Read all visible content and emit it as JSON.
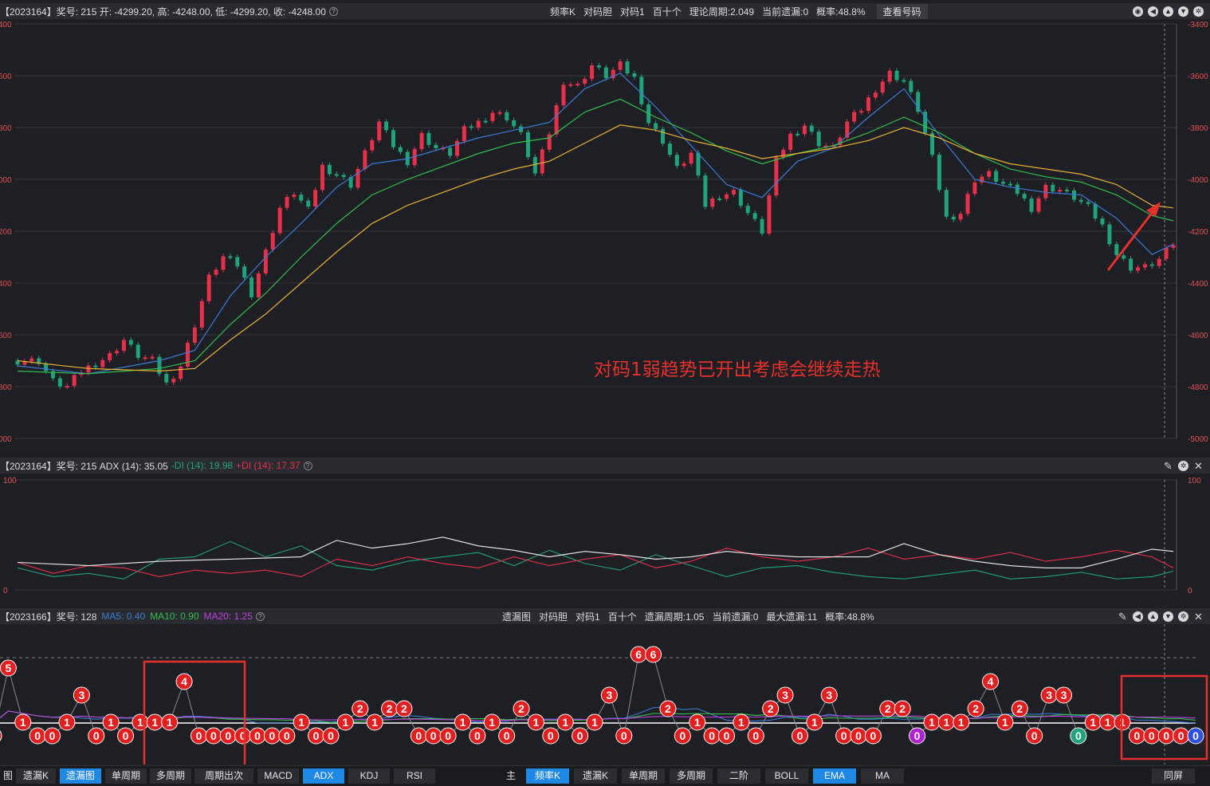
{
  "main_header": {
    "info": "【2023164】奖号: 215  开: -4299.20, 高: -4248.00, 低: -4299.20, 收: -4248.00",
    "center_items": [
      "频率K",
      "对码胆",
      "对码1",
      "百十个",
      "理论周期:2.049",
      "当前遗漏:0",
      "概率:48.8%"
    ],
    "button": "查看号码"
  },
  "adx_header": {
    "info": "【2023164】奖号: 215 ADX (14): 35.05",
    "di_minus": "-DI (14): 19.98",
    "di_plus": "+DI (14): 17.37"
  },
  "miss_header": {
    "info": "【2023166】奖号: 128",
    "ma5": "MA5: 0.40",
    "ma10": "MA10: 0.90",
    "ma20": "MA20: 1.25",
    "center_items": [
      "遗漏图",
      "对码胆",
      "对码1",
      "百十个",
      "遗漏周期:1.05",
      "当前遗漏:0",
      "最大遗漏:11",
      "概率:48.8%"
    ]
  },
  "annotation": "对码1弱趋势已开出考虑会继续走热",
  "bottom_tabs_left": [
    "图",
    "遗漏K",
    "遗漏图",
    "单周期",
    "多周期",
    "周期出次",
    "MACD",
    "ADX",
    "KDJ",
    "RSI"
  ],
  "bottom_tabs_right": [
    "主图",
    "频率K",
    "遗漏K",
    "单周期",
    "多周期",
    "二阶",
    "BOLL",
    "EMA",
    "MA"
  ],
  "bottom_sync": "同屏",
  "colors": {
    "up": "#e8304a",
    "down": "#1fa37a",
    "ema_fast": "#3a7bd5",
    "ema_mid": "#2ec04a",
    "ema_slow": "#e8b030",
    "annot": "#e8302a",
    "active_tab": "#1e88e5"
  },
  "chart_data": [
    {
      "type": "candlestick",
      "title": "",
      "ylim": [
        -5000,
        -3400
      ],
      "y_ticks": [
        "-3400",
        "-3600",
        "-3800",
        "-4000",
        "-4200",
        "-4400",
        "-4600",
        "-4800",
        "-5000"
      ],
      "left_ticks": [
        "400",
        "600",
        "800",
        "000",
        "200",
        "400",
        "600",
        "800",
        "000"
      ],
      "trend_path": [
        [
          0,
          -4700
        ],
        [
          3,
          -4700
        ],
        [
          5,
          -4780
        ],
        [
          7,
          -4800
        ],
        [
          9,
          -4740
        ],
        [
          11,
          -4710
        ],
        [
          13,
          -4680
        ],
        [
          15,
          -4620
        ],
        [
          17,
          -4680
        ],
        [
          19,
          -4700
        ],
        [
          21,
          -4790
        ],
        [
          23,
          -4720
        ],
        [
          25,
          -4560
        ],
        [
          27,
          -4380
        ],
        [
          29,
          -4300
        ],
        [
          31,
          -4330
        ],
        [
          33,
          -4440
        ],
        [
          35,
          -4280
        ],
        [
          37,
          -4110
        ],
        [
          39,
          -4050
        ],
        [
          41,
          -4120
        ],
        [
          43,
          -3950
        ],
        [
          45,
          -3980
        ],
        [
          47,
          -4020
        ],
        [
          49,
          -3900
        ],
        [
          51,
          -3780
        ],
        [
          53,
          -3870
        ],
        [
          55,
          -3930
        ],
        [
          57,
          -3830
        ],
        [
          59,
          -3880
        ],
        [
          61,
          -3900
        ],
        [
          63,
          -3810
        ],
        [
          65,
          -3780
        ],
        [
          67,
          -3740
        ],
        [
          69,
          -3760
        ],
        [
          71,
          -3830
        ],
        [
          73,
          -3980
        ],
        [
          75,
          -3820
        ],
        [
          77,
          -3620
        ],
        [
          79,
          -3640
        ],
        [
          81,
          -3560
        ],
        [
          83,
          -3600
        ],
        [
          85,
          -3560
        ],
        [
          87,
          -3610
        ],
        [
          89,
          -3780
        ],
        [
          91,
          -3850
        ],
        [
          93,
          -3960
        ],
        [
          95,
          -3900
        ],
        [
          97,
          -4100
        ],
        [
          99,
          -4060
        ],
        [
          101,
          -4050
        ],
        [
          103,
          -4130
        ],
        [
          105,
          -4200
        ],
        [
          107,
          -3930
        ],
        [
          109,
          -3830
        ],
        [
          111,
          -3790
        ],
        [
          113,
          -3860
        ],
        [
          115,
          -3880
        ],
        [
          117,
          -3780
        ],
        [
          119,
          -3730
        ],
        [
          121,
          -3650
        ],
        [
          123,
          -3590
        ],
        [
          125,
          -3620
        ],
        [
          127,
          -3730
        ],
        [
          129,
          -3920
        ],
        [
          131,
          -4150
        ],
        [
          133,
          -4130
        ],
        [
          135,
          -4000
        ],
        [
          137,
          -3980
        ],
        [
          139,
          -4020
        ],
        [
          141,
          -4050
        ],
        [
          143,
          -4110
        ],
        [
          145,
          -4030
        ],
        [
          147,
          -4040
        ],
        [
          149,
          -4070
        ],
        [
          151,
          -4110
        ],
        [
          153,
          -4180
        ],
        [
          155,
          -4290
        ],
        [
          157,
          -4340
        ],
        [
          159,
          -4340
        ],
        [
          161,
          -4310
        ],
        [
          163,
          -4248
        ]
      ],
      "ema_fast": [
        [
          0,
          -4720
        ],
        [
          10,
          -4750
        ],
        [
          20,
          -4700
        ],
        [
          25,
          -4660
        ],
        [
          30,
          -4450
        ],
        [
          35,
          -4300
        ],
        [
          40,
          -4170
        ],
        [
          45,
          -4030
        ],
        [
          50,
          -3940
        ],
        [
          55,
          -3920
        ],
        [
          60,
          -3880
        ],
        [
          65,
          -3840
        ],
        [
          70,
          -3810
        ],
        [
          75,
          -3780
        ],
        [
          80,
          -3650
        ],
        [
          85,
          -3590
        ],
        [
          90,
          -3720
        ],
        [
          95,
          -3870
        ],
        [
          100,
          -4020
        ],
        [
          105,
          -4070
        ],
        [
          110,
          -3930
        ],
        [
          115,
          -3880
        ],
        [
          120,
          -3760
        ],
        [
          125,
          -3650
        ],
        [
          130,
          -3830
        ],
        [
          135,
          -4000
        ],
        [
          140,
          -4030
        ],
        [
          145,
          -4050
        ],
        [
          150,
          -4060
        ],
        [
          155,
          -4150
        ],
        [
          160,
          -4290
        ],
        [
          163,
          -4250
        ]
      ],
      "ema_mid": [
        [
          0,
          -4740
        ],
        [
          10,
          -4750
        ],
        [
          20,
          -4730
        ],
        [
          25,
          -4700
        ],
        [
          30,
          -4560
        ],
        [
          35,
          -4440
        ],
        [
          40,
          -4300
        ],
        [
          45,
          -4170
        ],
        [
          50,
          -4060
        ],
        [
          55,
          -4000
        ],
        [
          60,
          -3950
        ],
        [
          65,
          -3900
        ],
        [
          70,
          -3860
        ],
        [
          75,
          -3840
        ],
        [
          80,
          -3740
        ],
        [
          85,
          -3690
        ],
        [
          90,
          -3760
        ],
        [
          95,
          -3820
        ],
        [
          100,
          -3890
        ],
        [
          105,
          -3940
        ],
        [
          110,
          -3900
        ],
        [
          115,
          -3870
        ],
        [
          120,
          -3820
        ],
        [
          125,
          -3760
        ],
        [
          130,
          -3820
        ],
        [
          135,
          -3900
        ],
        [
          140,
          -3960
        ],
        [
          145,
          -3990
        ],
        [
          150,
          -4010
        ],
        [
          155,
          -4060
        ],
        [
          160,
          -4140
        ],
        [
          163,
          -4160
        ]
      ],
      "ema_slow": [
        [
          0,
          -4700
        ],
        [
          10,
          -4730
        ],
        [
          20,
          -4740
        ],
        [
          25,
          -4730
        ],
        [
          30,
          -4620
        ],
        [
          35,
          -4520
        ],
        [
          40,
          -4400
        ],
        [
          45,
          -4280
        ],
        [
          50,
          -4170
        ],
        [
          55,
          -4100
        ],
        [
          60,
          -4050
        ],
        [
          65,
          -4000
        ],
        [
          70,
          -3960
        ],
        [
          75,
          -3930
        ],
        [
          80,
          -3860
        ],
        [
          85,
          -3790
        ],
        [
          90,
          -3810
        ],
        [
          95,
          -3850
        ],
        [
          100,
          -3880
        ],
        [
          105,
          -3920
        ],
        [
          110,
          -3900
        ],
        [
          115,
          -3880
        ],
        [
          120,
          -3850
        ],
        [
          125,
          -3800
        ],
        [
          130,
          -3840
        ],
        [
          135,
          -3900
        ],
        [
          140,
          -3940
        ],
        [
          145,
          -3960
        ],
        [
          150,
          -3980
        ],
        [
          155,
          -4020
        ],
        [
          160,
          -4100
        ],
        [
          163,
          -4110
        ]
      ]
    },
    {
      "type": "line",
      "title": "ADX",
      "ylim": [
        0,
        100
      ],
      "y_ticks": [
        "100",
        "0"
      ],
      "adx": [
        [
          0,
          25
        ],
        [
          10,
          22
        ],
        [
          20,
          26
        ],
        [
          30,
          28
        ],
        [
          40,
          30
        ],
        [
          45,
          45
        ],
        [
          50,
          38
        ],
        [
          55,
          42
        ],
        [
          60,
          48
        ],
        [
          65,
          40
        ],
        [
          70,
          36
        ],
        [
          75,
          30
        ],
        [
          80,
          35
        ],
        [
          85,
          32
        ],
        [
          90,
          28
        ],
        [
          95,
          30
        ],
        [
          100,
          35
        ],
        [
          105,
          32
        ],
        [
          110,
          30
        ],
        [
          115,
          30
        ],
        [
          120,
          30
        ],
        [
          125,
          42
        ],
        [
          130,
          32
        ],
        [
          135,
          26
        ],
        [
          140,
          22
        ],
        [
          145,
          20
        ],
        [
          150,
          20
        ],
        [
          155,
          28
        ],
        [
          160,
          37
        ],
        [
          163,
          35
        ]
      ],
      "di_minus": [
        [
          0,
          25
        ],
        [
          5,
          15
        ],
        [
          10,
          22
        ],
        [
          15,
          20
        ],
        [
          20,
          12
        ],
        [
          25,
          18
        ],
        [
          30,
          15
        ],
        [
          35,
          18
        ],
        [
          40,
          12
        ],
        [
          45,
          28
        ],
        [
          50,
          22
        ],
        [
          55,
          30
        ],
        [
          60,
          24
        ],
        [
          65,
          20
        ],
        [
          70,
          30
        ],
        [
          75,
          22
        ],
        [
          80,
          28
        ],
        [
          85,
          32
        ],
        [
          90,
          20
        ],
        [
          95,
          26
        ],
        [
          100,
          38
        ],
        [
          105,
          30
        ],
        [
          110,
          26
        ],
        [
          115,
          30
        ],
        [
          120,
          38
        ],
        [
          125,
          28
        ],
        [
          130,
          32
        ],
        [
          135,
          28
        ],
        [
          140,
          34
        ],
        [
          145,
          26
        ],
        [
          150,
          30
        ],
        [
          155,
          36
        ],
        [
          160,
          30
        ],
        [
          163,
          20
        ]
      ],
      "di_plus": [
        [
          0,
          20
        ],
        [
          5,
          12
        ],
        [
          10,
          15
        ],
        [
          15,
          10
        ],
        [
          20,
          28
        ],
        [
          25,
          30
        ],
        [
          30,
          44
        ],
        [
          35,
          30
        ],
        [
          40,
          40
        ],
        [
          45,
          22
        ],
        [
          50,
          18
        ],
        [
          55,
          26
        ],
        [
          60,
          30
        ],
        [
          65,
          34
        ],
        [
          70,
          22
        ],
        [
          75,
          36
        ],
        [
          80,
          24
        ],
        [
          85,
          18
        ],
        [
          90,
          32
        ],
        [
          95,
          22
        ],
        [
          100,
          12
        ],
        [
          105,
          20
        ],
        [
          110,
          22
        ],
        [
          115,
          16
        ],
        [
          120,
          12
        ],
        [
          125,
          10
        ],
        [
          130,
          14
        ],
        [
          135,
          18
        ],
        [
          140,
          10
        ],
        [
          145,
          12
        ],
        [
          150,
          16
        ],
        [
          155,
          10
        ],
        [
          160,
          12
        ],
        [
          163,
          17
        ]
      ]
    },
    {
      "type": "scatter",
      "title": "遗漏图",
      "misses": [
        0,
        5,
        1,
        0,
        0,
        1,
        3,
        0,
        1,
        0,
        1,
        1,
        1,
        4,
        0,
        0,
        0,
        0,
        0,
        0,
        0,
        1,
        0,
        0,
        1,
        2,
        1,
        2,
        2,
        0,
        0,
        0,
        1,
        0,
        1,
        0,
        2,
        1,
        0,
        1,
        0,
        1,
        3,
        0,
        6,
        6,
        2,
        0,
        1,
        0,
        0,
        1,
        0,
        2,
        3,
        0,
        1,
        3,
        0,
        0,
        0,
        2,
        2,
        0,
        1,
        1,
        1,
        2,
        4,
        1,
        2,
        0,
        3,
        3,
        0,
        1,
        1,
        1,
        0,
        0,
        0,
        0,
        0
      ]
    }
  ]
}
